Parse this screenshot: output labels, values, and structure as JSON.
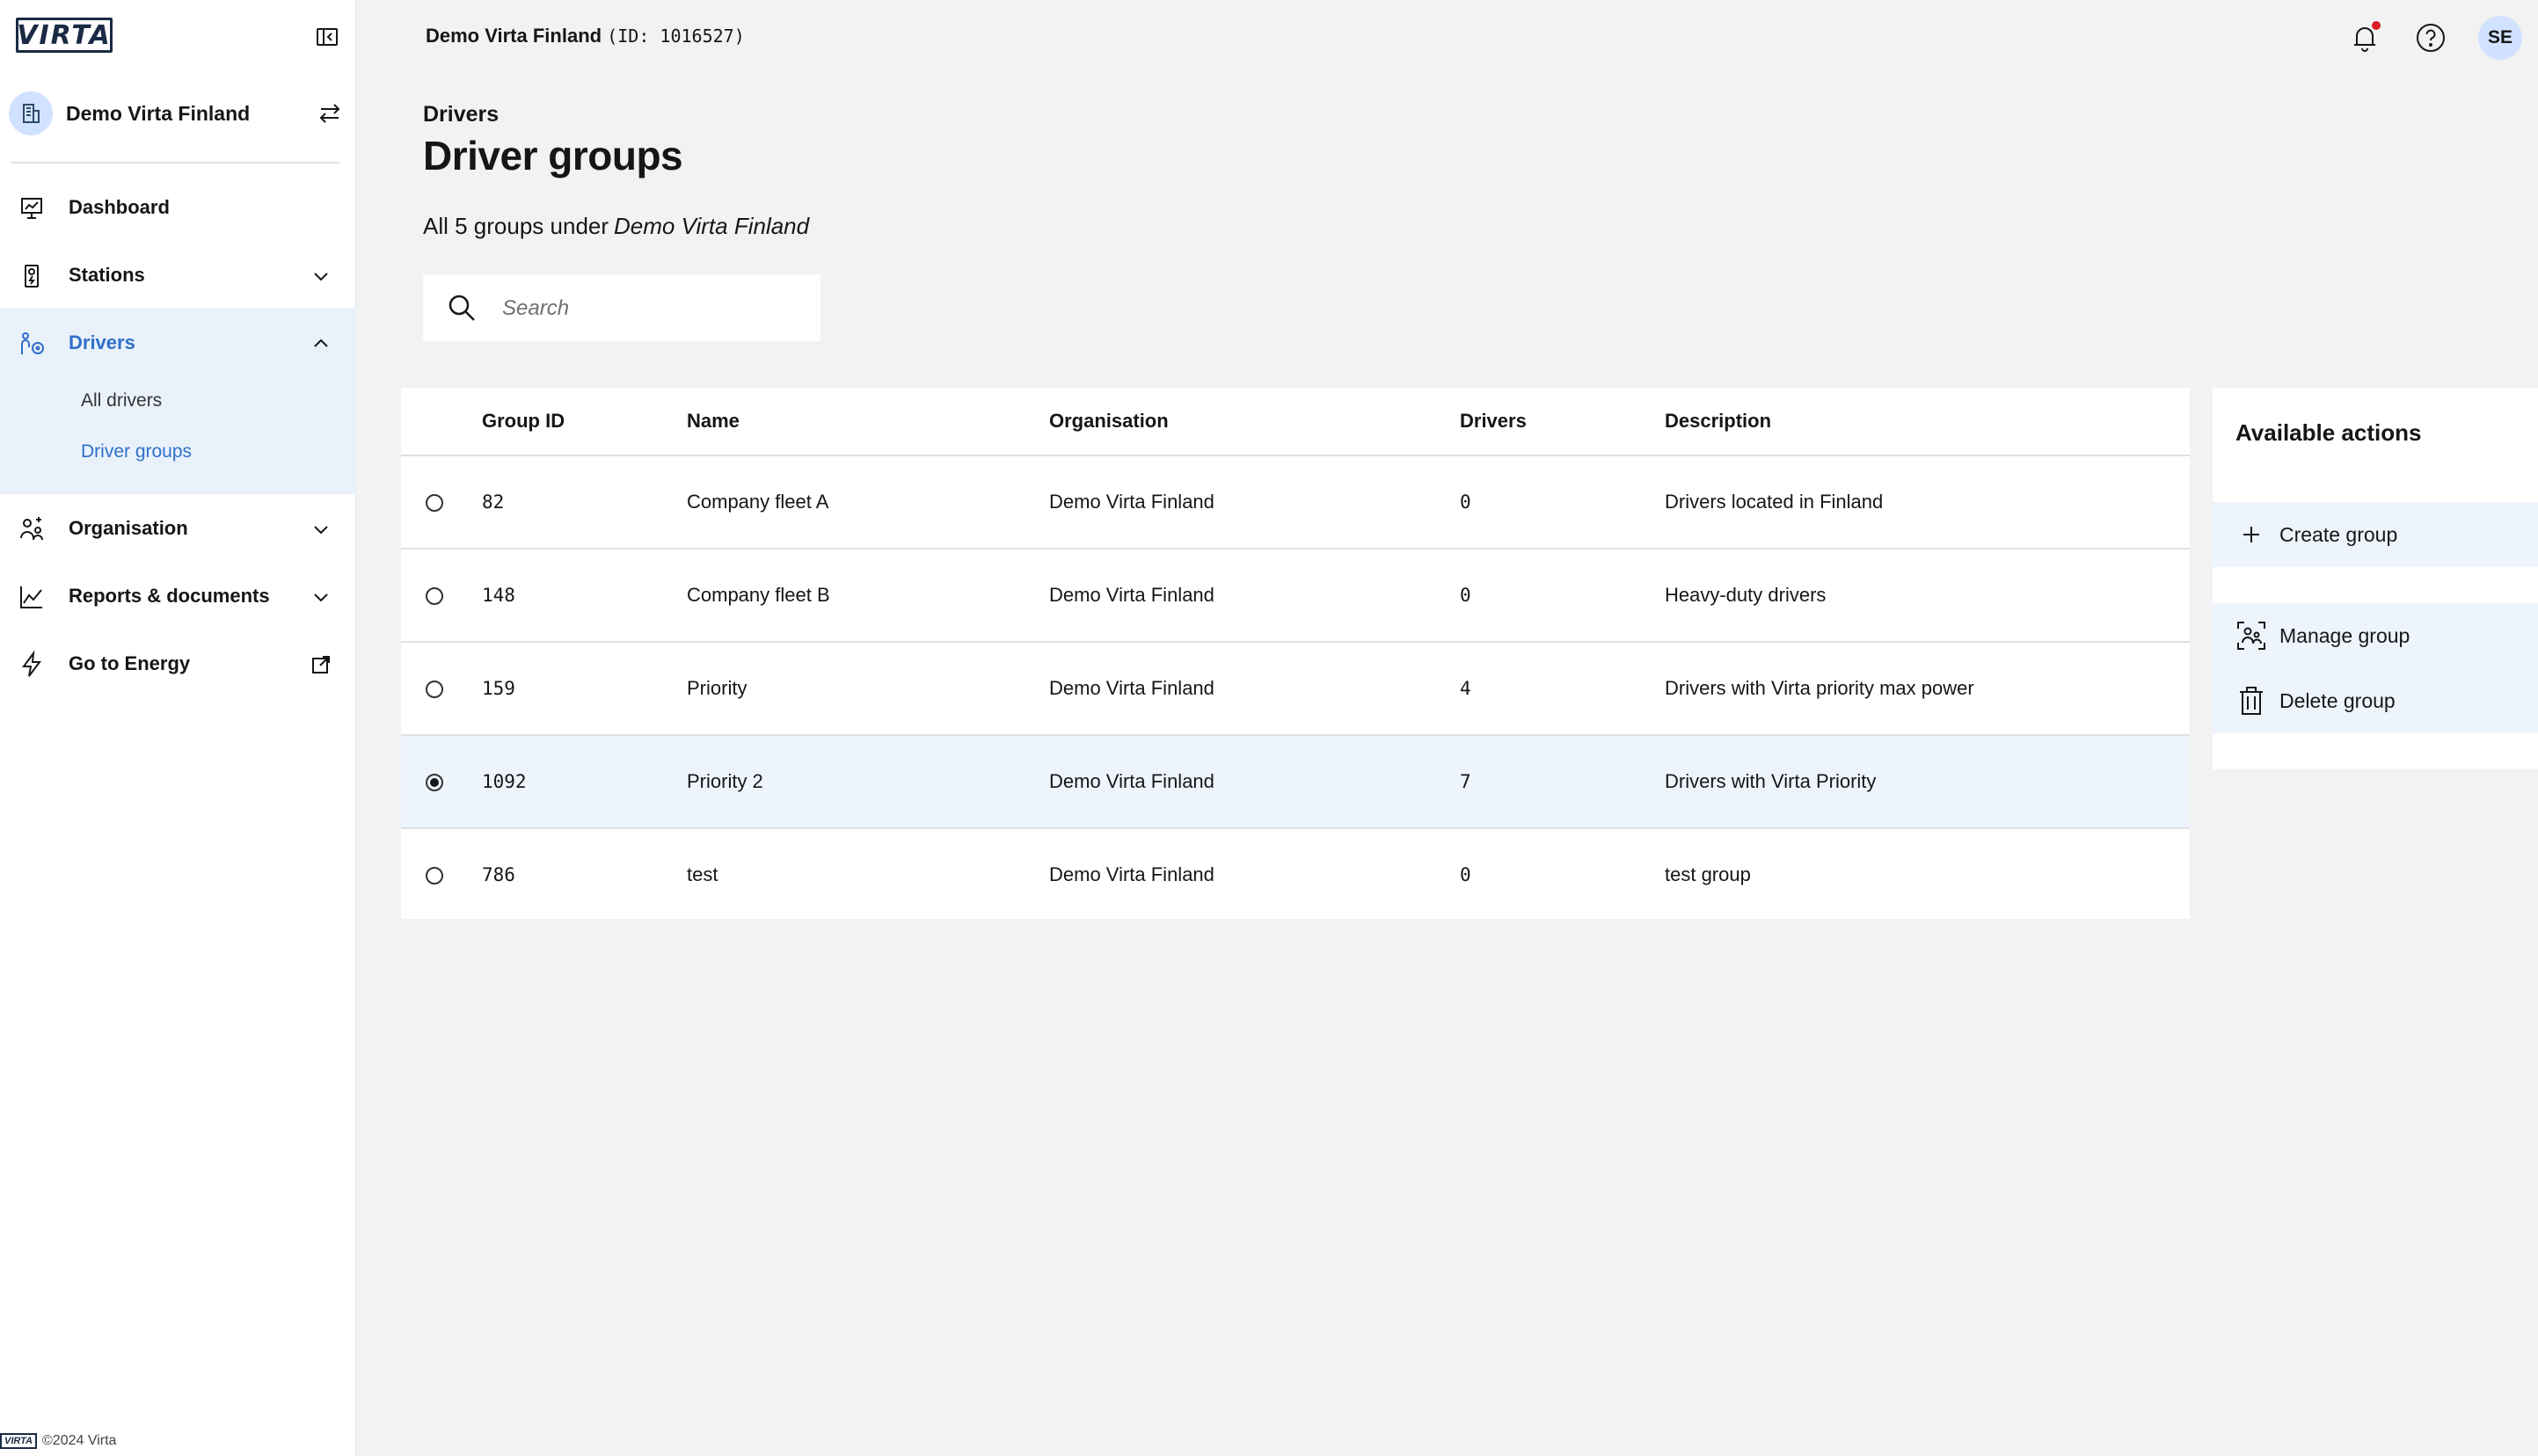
{
  "brand": {
    "logo_text": "VIRTA"
  },
  "sidebar": {
    "org_name": "Demo Virta Finland",
    "nav": {
      "dashboard": "Dashboard",
      "stations": "Stations",
      "drivers": "Drivers",
      "drivers_sub": {
        "all_drivers": "All drivers",
        "driver_groups": "Driver groups"
      },
      "organisation": "Organisation",
      "reports": "Reports & documents",
      "energy": "Go to Energy"
    },
    "footer": {
      "logo_text": "VIRTA",
      "copyright": "©2024 Virta"
    }
  },
  "topbar": {
    "org_name": "Demo Virta Finland",
    "org_id": "(ID: 1016527)",
    "user_initials": "SE"
  },
  "page": {
    "breadcrumb": "Drivers",
    "title": "Driver groups",
    "subtitle_prefix": "All 5 groups under",
    "subtitle_org": "Demo Virta Finland",
    "search_placeholder": "Search"
  },
  "table": {
    "columns": {
      "group_id": "Group ID",
      "name": "Name",
      "organisation": "Organisation",
      "drivers": "Drivers",
      "description": "Description"
    },
    "rows": [
      {
        "group_id": "82",
        "name": "Company fleet A",
        "organisation": "Demo Virta Finland",
        "drivers": "0",
        "description": "Drivers located in Finland"
      },
      {
        "group_id": "148",
        "name": "Company fleet B",
        "organisation": "Demo Virta Finland",
        "drivers": "0",
        "description": "Heavy-duty drivers"
      },
      {
        "group_id": "159",
        "name": "Priority",
        "organisation": "Demo Virta Finland",
        "drivers": "4",
        "description": "Drivers with Virta priority max power"
      },
      {
        "group_id": "1092",
        "name": "Priority 2",
        "organisation": "Demo Virta Finland",
        "drivers": "7",
        "description": "Drivers with Virta Priority"
      },
      {
        "group_id": "786",
        "name": "test",
        "organisation": "Demo Virta Finland",
        "drivers": "0",
        "description": "test group"
      }
    ],
    "selected_row": 3
  },
  "actions": {
    "title": "Available actions",
    "create": "Create group",
    "manage": "Manage group",
    "delete": "Delete group"
  },
  "colors": {
    "accent": "#2f6fc9",
    "selection_bg": "#edf4fc",
    "avatar_bg": "#d0e2ff",
    "notification_dot": "#da1e28"
  },
  "icons": [
    "collapse-sidebar-icon",
    "building-icon",
    "switch-icon",
    "dashboard-icon",
    "station-icon",
    "drivers-icon",
    "organisation-icon",
    "reports-icon",
    "lightning-icon",
    "external-link-icon",
    "bell-icon",
    "help-icon",
    "search-icon",
    "plus-icon",
    "manage-group-icon",
    "trash-icon",
    "chevron-down-icon",
    "chevron-up-icon"
  ]
}
